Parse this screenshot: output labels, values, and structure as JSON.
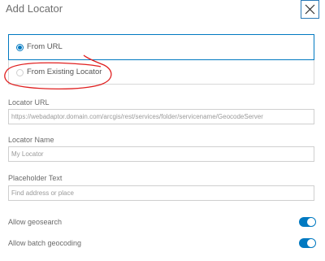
{
  "dialog": {
    "title": "Add Locator",
    "close_icon": "close-icon"
  },
  "source_options": [
    {
      "label": "From URL",
      "selected": true
    },
    {
      "label": "From Existing Locator",
      "selected": false
    }
  ],
  "fields": {
    "locator_url": {
      "label": "Locator URL",
      "value": "",
      "placeholder": "https://webadaptor.domain.com/arcgis/rest/services/folder/servicename/GeocodeServer"
    },
    "locator_name": {
      "label": "Locator Name",
      "value": "",
      "placeholder": "My Locator"
    },
    "placeholder_text": {
      "label": "Placeholder Text",
      "value": "",
      "placeholder": "Find address or place"
    }
  },
  "toggles": {
    "geosearch": {
      "label": "Allow geosearch",
      "on": true
    },
    "batch_geocoding": {
      "label": "Allow batch geocoding",
      "on": true
    }
  },
  "colors": {
    "accent": "#0079c1",
    "annotation": "#e02020"
  }
}
